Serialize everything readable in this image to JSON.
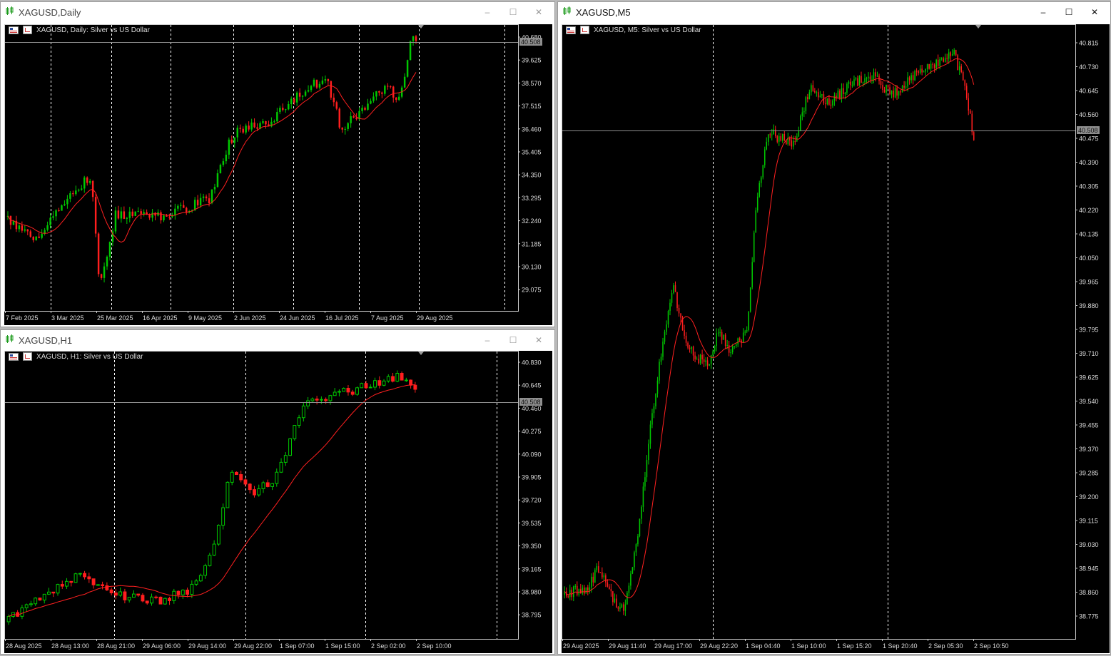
{
  "windows": {
    "daily": {
      "title": "XAGUSD,Daily",
      "chart_title": "XAGUSD, Daily:  Silver vs US Dollar",
      "price_labels": [
        "40.680",
        "39.625",
        "38.570",
        "37.515",
        "36.460",
        "35.405",
        "34.350",
        "33.295",
        "32.240",
        "31.185",
        "30.130",
        "29.075"
      ],
      "current_price": "40.508",
      "time_labels": [
        "7 Feb 2025",
        "3 Mar 2025",
        "25 Mar 2025",
        "16 Apr 2025",
        "9 May 2025",
        "2 Jun 2025",
        "24 Jun 2025",
        "16 Jul 2025",
        "7 Aug 2025",
        "29 Aug 2025"
      ]
    },
    "h1": {
      "title": "XAGUSD,H1",
      "chart_title": "XAGUSD, H1:  Silver vs US Dollar",
      "price_labels": [
        "40.830",
        "40.645",
        "40.460",
        "40.275",
        "40.090",
        "39.905",
        "39.720",
        "39.535",
        "39.350",
        "39.165",
        "38.980",
        "38.795"
      ],
      "current_price": "40.508",
      "time_labels": [
        "28 Aug 2025",
        "28 Aug 13:00",
        "28 Aug 21:00",
        "29 Aug 06:00",
        "29 Aug 14:00",
        "29 Aug 22:00",
        "1 Sep 07:00",
        "1 Sep 15:00",
        "2 Sep 02:00",
        "2 Sep 10:00"
      ]
    },
    "m5": {
      "title": "XAGUSD,M5",
      "chart_title": "XAGUSD, M5:  Silver vs US Dollar",
      "price_labels": [
        "40.815",
        "40.730",
        "40.645",
        "40.560",
        "40.475",
        "40.390",
        "40.305",
        "40.220",
        "40.135",
        "40.050",
        "39.965",
        "39.880",
        "39.795",
        "39.710",
        "39.625",
        "39.540",
        "39.455",
        "39.370",
        "39.285",
        "39.200",
        "39.115",
        "39.030",
        "38.945",
        "38.860",
        "38.775"
      ],
      "current_price": "40.508",
      "time_labels": [
        "29 Aug 2025",
        "29 Aug 11:40",
        "29 Aug 17:00",
        "29 Aug 22:20",
        "1 Sep 04:40",
        "1 Sep 10:00",
        "1 Sep 15:20",
        "1 Sep 20:40",
        "2 Sep 05:30",
        "2 Sep 10:50"
      ]
    }
  },
  "colors": {
    "bull": "#00c800",
    "bear": "#ff1e1e",
    "ma": "#ff2020",
    "grid": "#ffffff",
    "axis_text": "#dcdcdc",
    "price_line": "#8f8f8f",
    "price_tag_bg": "#8f8f8f"
  },
  "icons": {
    "window": "chart-bars-icon",
    "minimize": "minimize-icon",
    "maximize": "maximize-icon",
    "close": "close-icon"
  }
}
